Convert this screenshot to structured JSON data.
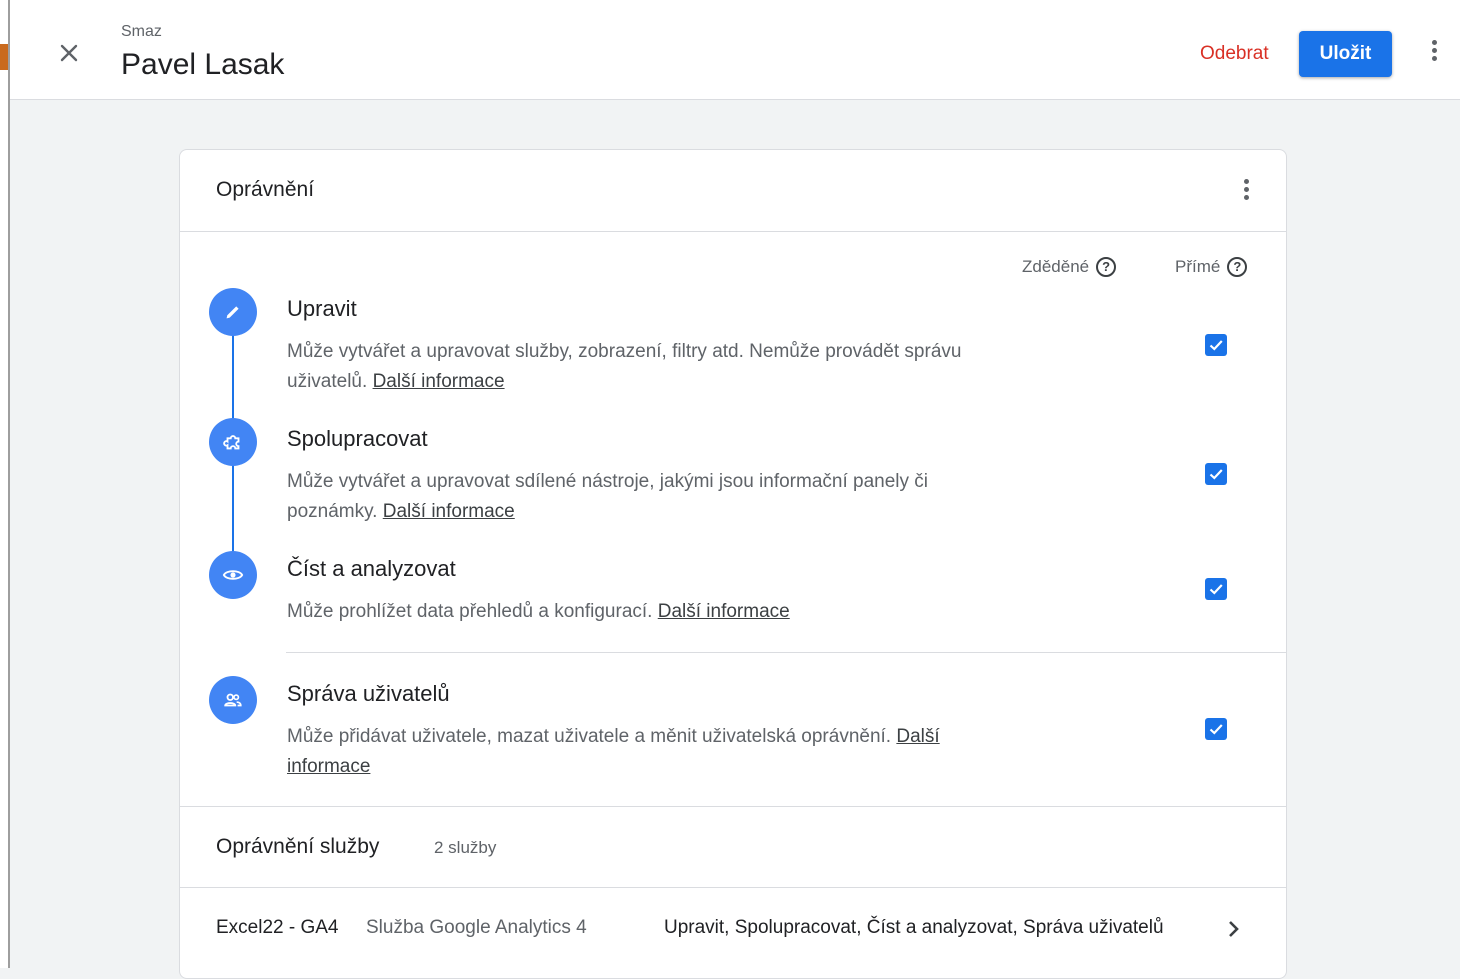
{
  "header": {
    "eyebrow": "Smaz",
    "title": "Pavel Lasak",
    "remove_label": "Odebrat",
    "save_label": "Uložit"
  },
  "permissions": {
    "title": "Oprávnění",
    "col_inherited": "Zděděné",
    "col_direct": "Přímé",
    "help_glyph": "?",
    "items": [
      {
        "icon": "pencil-icon",
        "title": "Upravit",
        "desc": "Může vytvářet a upravovat služby, zobrazení, filtry atd. Nemůže provádět správu uživatelů.",
        "link": "Další informace",
        "direct_checked": true
      },
      {
        "icon": "puzzle-icon",
        "title": "Spolupracovat",
        "desc": "Může vytvářet a upravovat sdílené nástroje, jakými jsou informační panely či poznámky.",
        "link": "Další informace",
        "direct_checked": true
      },
      {
        "icon": "eye-icon",
        "title": "Číst a analyzovat",
        "desc": "Může prohlížet data přehledů a konfigurací.",
        "link": "Další informace",
        "direct_checked": true
      },
      {
        "icon": "people-icon",
        "title": "Správa uživatelů",
        "desc": "Může přidávat uživatele, mazat uživatele a měnit uživatelská oprávnění.",
        "link": "Další informace",
        "direct_checked": true
      }
    ]
  },
  "services": {
    "title": "Oprávnění služby",
    "count": "2 služby",
    "rows": [
      {
        "name": "Excel22 - GA4",
        "type": "Služba Google Analytics 4",
        "roles": "Upravit, Spolupracovat, Číst a analyzovat, Správa uživatelů"
      }
    ]
  },
  "colors": {
    "accent": "#1a73e8",
    "danger": "#d93025",
    "icon_bg": "#4285f4"
  }
}
